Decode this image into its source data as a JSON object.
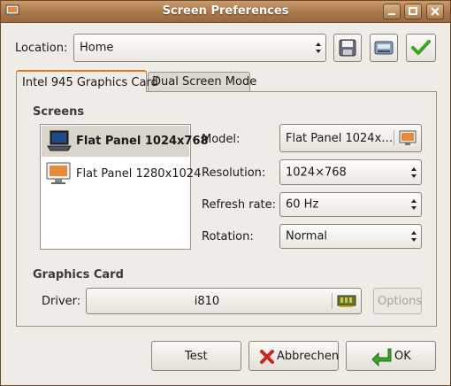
{
  "window": {
    "title": "Screen Preferences"
  },
  "location": {
    "label": "Location:",
    "value": "Home"
  },
  "tabs": [
    {
      "label": "Intel 945 Graphics Card",
      "active": true
    },
    {
      "label": "Dual Screen Mode",
      "active": false
    }
  ],
  "screens": {
    "heading": "Screens",
    "items": [
      {
        "label": "Flat Panel 1024x768",
        "selected": true
      },
      {
        "label": "Flat Panel 1280x1024",
        "selected": false
      }
    ]
  },
  "settings": {
    "model_label": "Model:",
    "model_value": "Flat Panel 1024x…",
    "resolution_label": "Resolution:",
    "resolution_value": "1024×768",
    "refresh_label": "Refresh rate:",
    "refresh_value": "60 Hz",
    "rotation_label": "Rotation:",
    "rotation_value": "Normal"
  },
  "graphics_card": {
    "heading": "Graphics Card",
    "driver_label": "Driver:",
    "driver_value": "i810",
    "options_label": "Options"
  },
  "buttons": {
    "test": "Test",
    "cancel": "Abbrechen",
    "ok": "OK"
  },
  "colors": {
    "titlebar": "#a8774a",
    "tab_accent": "#e07a1a",
    "ok_green": "#3fa32a"
  }
}
